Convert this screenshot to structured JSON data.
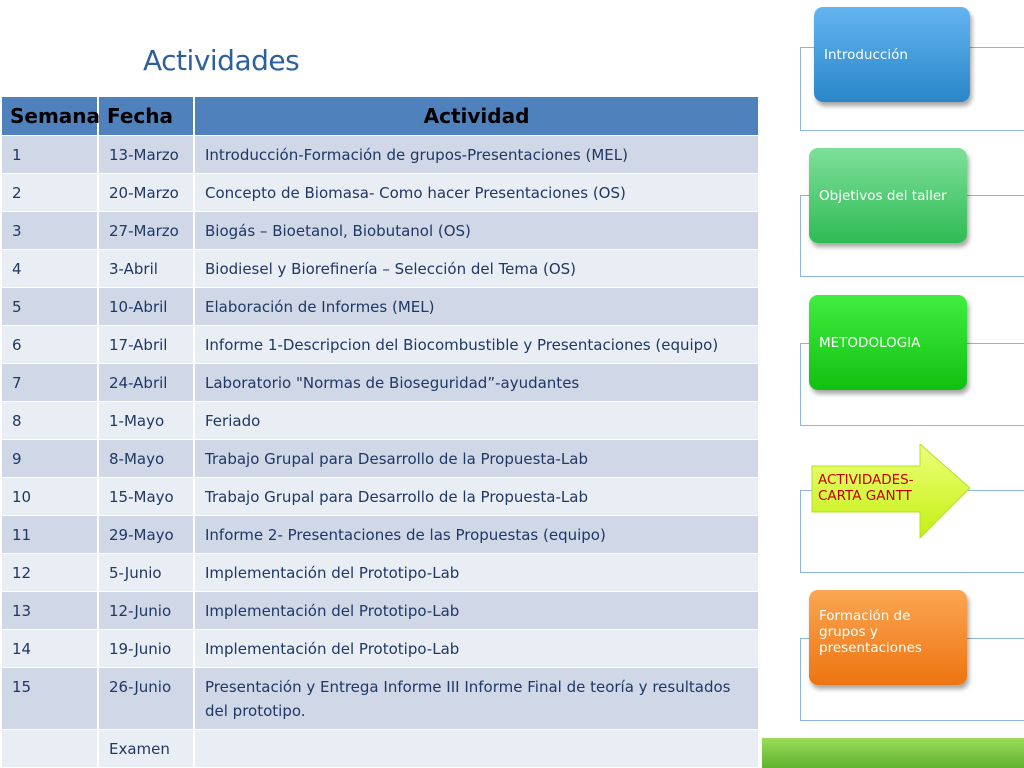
{
  "title": "Actividades",
  "table": {
    "headers": [
      "Semana",
      "Fecha",
      "Actividad"
    ],
    "rows": [
      {
        "semana": "1",
        "fecha": "13-Marzo",
        "actividad": "Introducción-Formación de grupos-Presentaciones (MEL)"
      },
      {
        "semana": "2",
        "fecha": "20-Marzo",
        "actividad": "Concepto de Biomasa- Como hacer Presentaciones (OS)"
      },
      {
        "semana": "3",
        "fecha": "27-Marzo",
        "actividad": "Biogás – Bioetanol,  Biobutanol (OS)"
      },
      {
        "semana": "4",
        "fecha": "3-Abril",
        "actividad": "Biodiesel y Biorefinería – Selección del Tema (OS)"
      },
      {
        "semana": "5",
        "fecha": "10-Abril",
        "actividad": "Elaboración de Informes (MEL)"
      },
      {
        "semana": "6",
        "fecha": "17-Abril",
        "actividad": "Informe 1-Descripcion del Biocombustible y Presentaciones (equipo)"
      },
      {
        "semana": "7",
        "fecha": "24-Abril",
        "actividad": "Laboratorio   \"Normas de Bioseguridad”-ayudantes"
      },
      {
        "semana": "8",
        "fecha": "1-Mayo",
        "actividad": "Feriado"
      },
      {
        "semana": "9",
        "fecha": "8-Mayo",
        "actividad": "Trabajo Grupal para Desarrollo de la Propuesta-Lab"
      },
      {
        "semana": "10",
        "fecha": "15-Mayo",
        "actividad": "Trabajo Grupal para Desarrollo de la Propuesta-Lab"
      },
      {
        "semana": "11",
        "fecha": "29-Mayo",
        "actividad": "Informe 2- Presentaciones de las Propuestas (equipo)"
      },
      {
        "semana": "12",
        "fecha": "5-Junio",
        "actividad": "Implementación del Prototipo-Lab"
      },
      {
        "semana": "13",
        "fecha": "12-Junio",
        "actividad": "Implementación del Prototipo-Lab"
      },
      {
        "semana": "14",
        "fecha": "19-Junio",
        "actividad": "Implementación del Prototipo-Lab"
      },
      {
        "semana": "15",
        "fecha": "26-Junio",
        "actividad": "Presentación y Entrega Informe III    Informe Final de teoría y resultados del prototipo."
      },
      {
        "semana": "",
        "fecha": "Examen",
        "actividad": ""
      }
    ]
  },
  "nav": {
    "introduccion": "Introducción",
    "objetivos": "Objetivos del taller",
    "metodologia": "METODOLOGIA",
    "actividades_line1": "ACTIVIDADES-",
    "actividades_line2": "CARTA GANTT",
    "formacion": "Formación de grupos y presentaciones"
  },
  "colors": {
    "header_blue": "#4f81bd",
    "title_blue": "#2e5f9e",
    "row_odd": "#d0d8e8",
    "row_even": "#e9edf4",
    "active_text": "#c00000"
  }
}
